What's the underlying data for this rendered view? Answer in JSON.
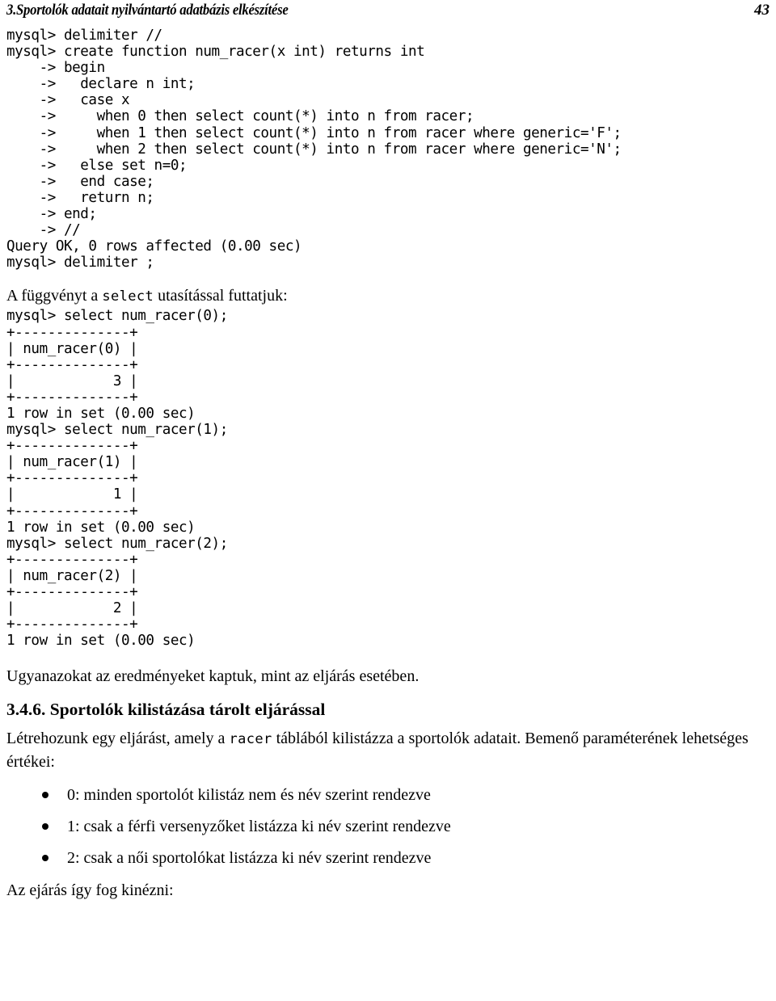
{
  "header": {
    "title": "3.Sportolók adatait nyilvántartó adatbázis elkészítése",
    "page_number": "43"
  },
  "code_blocks": {
    "create_function": "mysql> delimiter //\nmysql> create function num_racer(x int) returns int\n    -> begin\n    ->   declare n int;\n    ->   case x\n    ->     when 0 then select count(*) into n from racer;\n    ->     when 1 then select count(*) into n from racer where generic='F';\n    ->     when 2 then select count(*) into n from racer where generic='N';\n    ->   else set n=0;\n    ->   end case;\n    ->   return n;\n    -> end;\n    -> //\nQuery OK, 0 rows affected (0.00 sec)",
    "delimiter_reset": "mysql> delimiter ;",
    "select_0": "mysql> select num_racer(0);\n+--------------+\n| num_racer(0) |\n+--------------+\n|            3 |\n+--------------+\n1 row in set (0.00 sec)",
    "select_1": "mysql> select num_racer(1);\n+--------------+\n| num_racer(1) |\n+--------------+\n|            1 |\n+--------------+\n1 row in set (0.00 sec)",
    "select_2": "mysql> select num_racer(2);\n+--------------+\n| num_racer(2) |\n+--------------+\n|            2 |\n+--------------+\n1 row in set (0.00 sec)"
  },
  "body": {
    "select_intro_before": "A függvényt a ",
    "select_intro_code": "select",
    "select_intro_after": " utasítással futtatjuk:",
    "same_results": "Ugyanazokat az eredményeket kaptuk, mint az eljárás esetében.",
    "section_heading": "3.4.6. Sportolók kilistázása tárolt eljárással",
    "procedure_intro_before": "Létrehozunk egy eljárást, amely a ",
    "procedure_intro_code": "racer",
    "procedure_intro_after": " táblából kilistázza a sportolók adatait. Bemenő paraméterének lehetséges értékei:",
    "closing": "Az ejárás így fog kinézni:"
  },
  "bullets": [
    "0: minden sportolót kilistáz nem és név szerint rendezve",
    "1: csak a férfi versenyzőket listázza ki név szerint rendezve",
    "2: csak a női sportolókat listázza ki név szerint rendezve"
  ]
}
